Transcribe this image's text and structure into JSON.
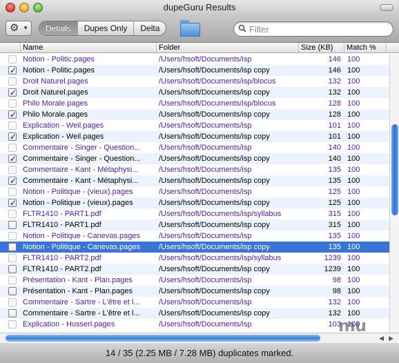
{
  "window": {
    "title": "dupeGuru Results"
  },
  "toolbar": {
    "actions_icon": "gear-icon",
    "segments": [
      "Details",
      "Dupes Only",
      "Delta"
    ],
    "folder_icon": "folder-icon",
    "search_placeholder": "Filter",
    "search_value": ""
  },
  "table": {
    "columns": [
      "Name",
      "Folder",
      "Size (KB)",
      "Match %"
    ],
    "rows": [
      {
        "ref": true,
        "checked": false,
        "selected": false,
        "name": "Notion - Politic.pages",
        "folder": "/Users/hsoft/Documents/isp",
        "size": "146",
        "match": "100"
      },
      {
        "ref": false,
        "checked": true,
        "selected": false,
        "name": "Notion - Politic.pages",
        "folder": "/Users/hsoft/Documents/isp copy",
        "size": "146",
        "match": "100"
      },
      {
        "ref": true,
        "checked": false,
        "selected": false,
        "name": "Droit Naturel.pages",
        "folder": "/Users/hsoft/Documents/isp/blocus",
        "size": "132",
        "match": "100"
      },
      {
        "ref": false,
        "checked": true,
        "selected": false,
        "name": "Droit Naturel.pages",
        "folder": "/Users/hsoft/Documents/isp copy",
        "size": "132",
        "match": "100"
      },
      {
        "ref": true,
        "checked": false,
        "selected": false,
        "name": "Philo Morale.pages",
        "folder": "/Users/hsoft/Documents/isp/blocus",
        "size": "128",
        "match": "100"
      },
      {
        "ref": false,
        "checked": true,
        "selected": false,
        "name": "Philo Morale.pages",
        "folder": "/Users/hsoft/Documents/isp copy",
        "size": "128",
        "match": "100"
      },
      {
        "ref": true,
        "checked": false,
        "selected": false,
        "name": "Explication - Weil.pages",
        "folder": "/Users/hsoft/Documents/isp",
        "size": "101",
        "match": "100"
      },
      {
        "ref": false,
        "checked": true,
        "selected": false,
        "name": "Explication - Weil.pages",
        "folder": "/Users/hsoft/Documents/isp copy",
        "size": "101",
        "match": "100"
      },
      {
        "ref": true,
        "checked": false,
        "selected": false,
        "name": "Commentaire - Singer - Question...",
        "folder": "/Users/hsoft/Documents/isp",
        "size": "140",
        "match": "100"
      },
      {
        "ref": false,
        "checked": true,
        "selected": false,
        "name": "Commentaire - Singer - Question...",
        "folder": "/Users/hsoft/Documents/isp copy",
        "size": "140",
        "match": "100"
      },
      {
        "ref": true,
        "checked": false,
        "selected": false,
        "name": "Commentaire - Kant - Métaphysi...",
        "folder": "/Users/hsoft/Documents/isp",
        "size": "135",
        "match": "100"
      },
      {
        "ref": false,
        "checked": true,
        "selected": false,
        "name": "Commentaire - Kant - Métaphysi...",
        "folder": "/Users/hsoft/Documents/isp copy",
        "size": "135",
        "match": "100"
      },
      {
        "ref": true,
        "checked": false,
        "selected": false,
        "name": "Notion - Politique - (vieux).pages",
        "folder": "/Users/hsoft/Documents/isp",
        "size": "125",
        "match": "100"
      },
      {
        "ref": false,
        "checked": true,
        "selected": false,
        "name": "Notion - Politique - (vieux).pages",
        "folder": "/Users/hsoft/Documents/isp copy",
        "size": "125",
        "match": "100"
      },
      {
        "ref": true,
        "checked": false,
        "selected": false,
        "name": "FLTR1410 - PART1.pdf",
        "folder": "/Users/hsoft/Documents/isp/syllabus",
        "size": "315",
        "match": "100"
      },
      {
        "ref": false,
        "checked": false,
        "selected": false,
        "name": "FLTR1410 - PART1.pdf",
        "folder": "/Users/hsoft/Documents/isp copy",
        "size": "315",
        "match": "100"
      },
      {
        "ref": true,
        "checked": false,
        "selected": false,
        "name": "Notion - Politique - Canevas.pages",
        "folder": "/Users/hsoft/Documents/isp",
        "size": "135",
        "match": "100"
      },
      {
        "ref": false,
        "checked": false,
        "selected": true,
        "name": "Notion - Politique - Canevas.pages",
        "folder": "/Users/hsoft/Documents/isp copy",
        "size": "135",
        "match": "100"
      },
      {
        "ref": true,
        "checked": false,
        "selected": false,
        "name": "FLTR1410 - PART2.pdf",
        "folder": "/Users/hsoft/Documents/isp/syllabus",
        "size": "1239",
        "match": "100"
      },
      {
        "ref": false,
        "checked": false,
        "selected": false,
        "name": "FLTR1410 - PART2.pdf",
        "folder": "/Users/hsoft/Documents/isp copy",
        "size": "1239",
        "match": "100"
      },
      {
        "ref": true,
        "checked": false,
        "selected": false,
        "name": "Présentation - Kant - Plan.pages",
        "folder": "/Users/hsoft/Documents/isp",
        "size": "98",
        "match": "100"
      },
      {
        "ref": false,
        "checked": false,
        "selected": false,
        "name": "Présentation - Kant - Plan.pages",
        "folder": "/Users/hsoft/Documents/isp copy",
        "size": "98",
        "match": "100"
      },
      {
        "ref": true,
        "checked": false,
        "selected": false,
        "name": "Commentaire - Sartre - L'être et l...",
        "folder": "/Users/hsoft/Documents/isp",
        "size": "132",
        "match": "100"
      },
      {
        "ref": false,
        "checked": false,
        "selected": false,
        "name": "Commentaire - Sartre - L'être et l...",
        "folder": "/Users/hsoft/Documents/isp copy",
        "size": "132",
        "match": "100"
      },
      {
        "ref": true,
        "checked": false,
        "selected": false,
        "name": "Explication - Husserl.pages",
        "folder": "/Users/hsoft/Documents/isp",
        "size": "103",
        "match": "100"
      }
    ]
  },
  "status": {
    "text": "14 / 35 (2.25 MB / 7.28 MB) duplicates marked."
  },
  "watermark": "mu",
  "colors": {
    "ref_text": "#4a1aa8",
    "selection": "#3875d7",
    "alt_row": "#edf3fe"
  }
}
